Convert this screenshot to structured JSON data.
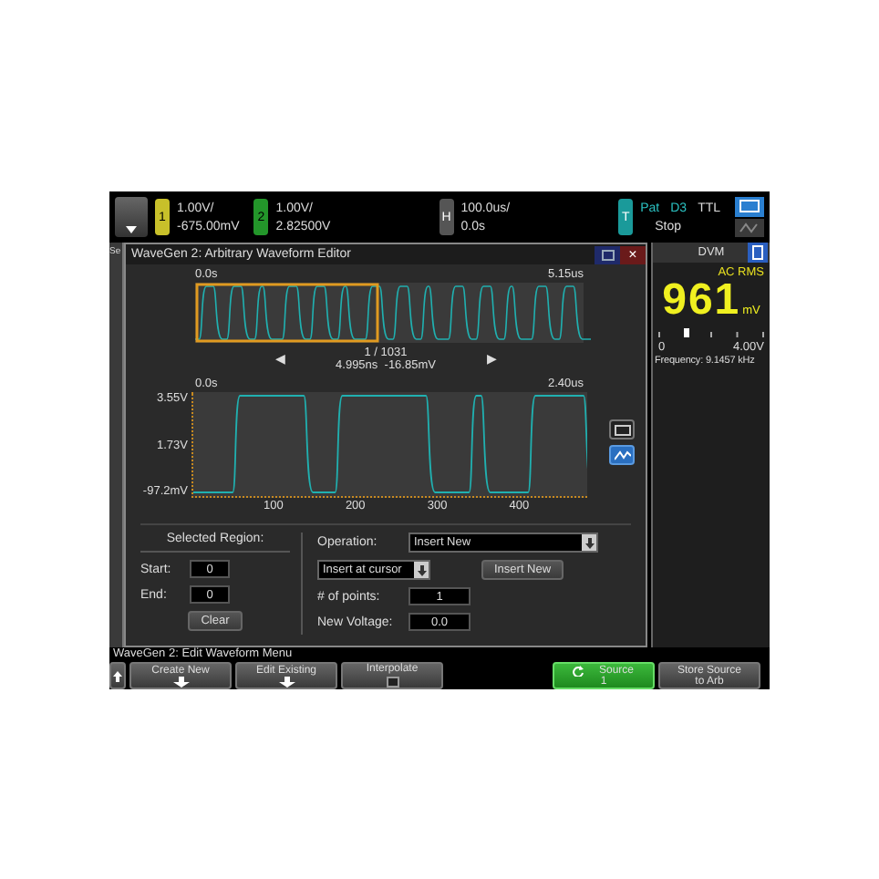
{
  "top_bar": {
    "channels": [
      {
        "number": "1",
        "scale": "1.00V/",
        "offset": "-675.00mV",
        "color": "#c8c02a"
      },
      {
        "number": "2",
        "scale": "1.00V/",
        "offset": "2.82500V",
        "color": "#23962a"
      }
    ],
    "horizontal": {
      "label": "H",
      "scale": "100.0us/",
      "delay": "0.0s"
    },
    "trigger": {
      "label": "T",
      "mode": "Pat",
      "source": "D3",
      "type": "TTL",
      "status": "Stop"
    }
  },
  "sidebar_fragment": "Se",
  "dialog": {
    "title": "WaveGen 2: Arbitrary Waveform Editor",
    "close_symbol": "×",
    "overview": {
      "start": "0.0s",
      "end": "5.15us"
    },
    "navigator": {
      "prev": "◀",
      "position": "1 / 1031",
      "readout": "4.995ns  -16.85mV",
      "next": "▶"
    },
    "detail": {
      "start": "0.0s",
      "end": "2.40us",
      "y_labels": [
        "3.55V",
        "1.73V",
        "-97.2mV"
      ],
      "x_labels": [
        "100",
        "200",
        "300",
        "400"
      ]
    },
    "view_modes": [
      {
        "selected": false
      },
      {
        "selected": true
      }
    ],
    "selected_region": {
      "title": "Selected Region:",
      "start_label": "Start:",
      "start": "0",
      "end_label": "End:",
      "end": "0",
      "clear": "Clear"
    },
    "operation": {
      "label": "Operation:",
      "value": "Insert New",
      "insert_mode": "Insert at cursor",
      "apply": "Insert New",
      "points_label": "# of points:",
      "points": "1",
      "voltage_label": "New Voltage:",
      "voltage": "0.0"
    }
  },
  "dvm": {
    "title": "DVM",
    "mode": "AC RMS",
    "value": "961",
    "unit": "mV",
    "level": 0.24,
    "scale_min": "0",
    "scale_max": "4.00V",
    "frequency": "Frequency: 9.1457 kHz"
  },
  "status_line": "WaveGen 2: Edit Waveform Menu",
  "softkeys": [
    {
      "kind": "up"
    },
    {
      "kind": "menu",
      "label": "Create New"
    },
    {
      "kind": "menu",
      "label": "Edit Existing"
    },
    {
      "kind": "checkbox",
      "label": "Interpolate",
      "checked": false
    },
    {
      "kind": "blank"
    },
    {
      "kind": "toggle",
      "label": "Source",
      "value": "1",
      "selected": true
    },
    {
      "kind": "action",
      "label": "Store Source to Arb"
    }
  ]
}
